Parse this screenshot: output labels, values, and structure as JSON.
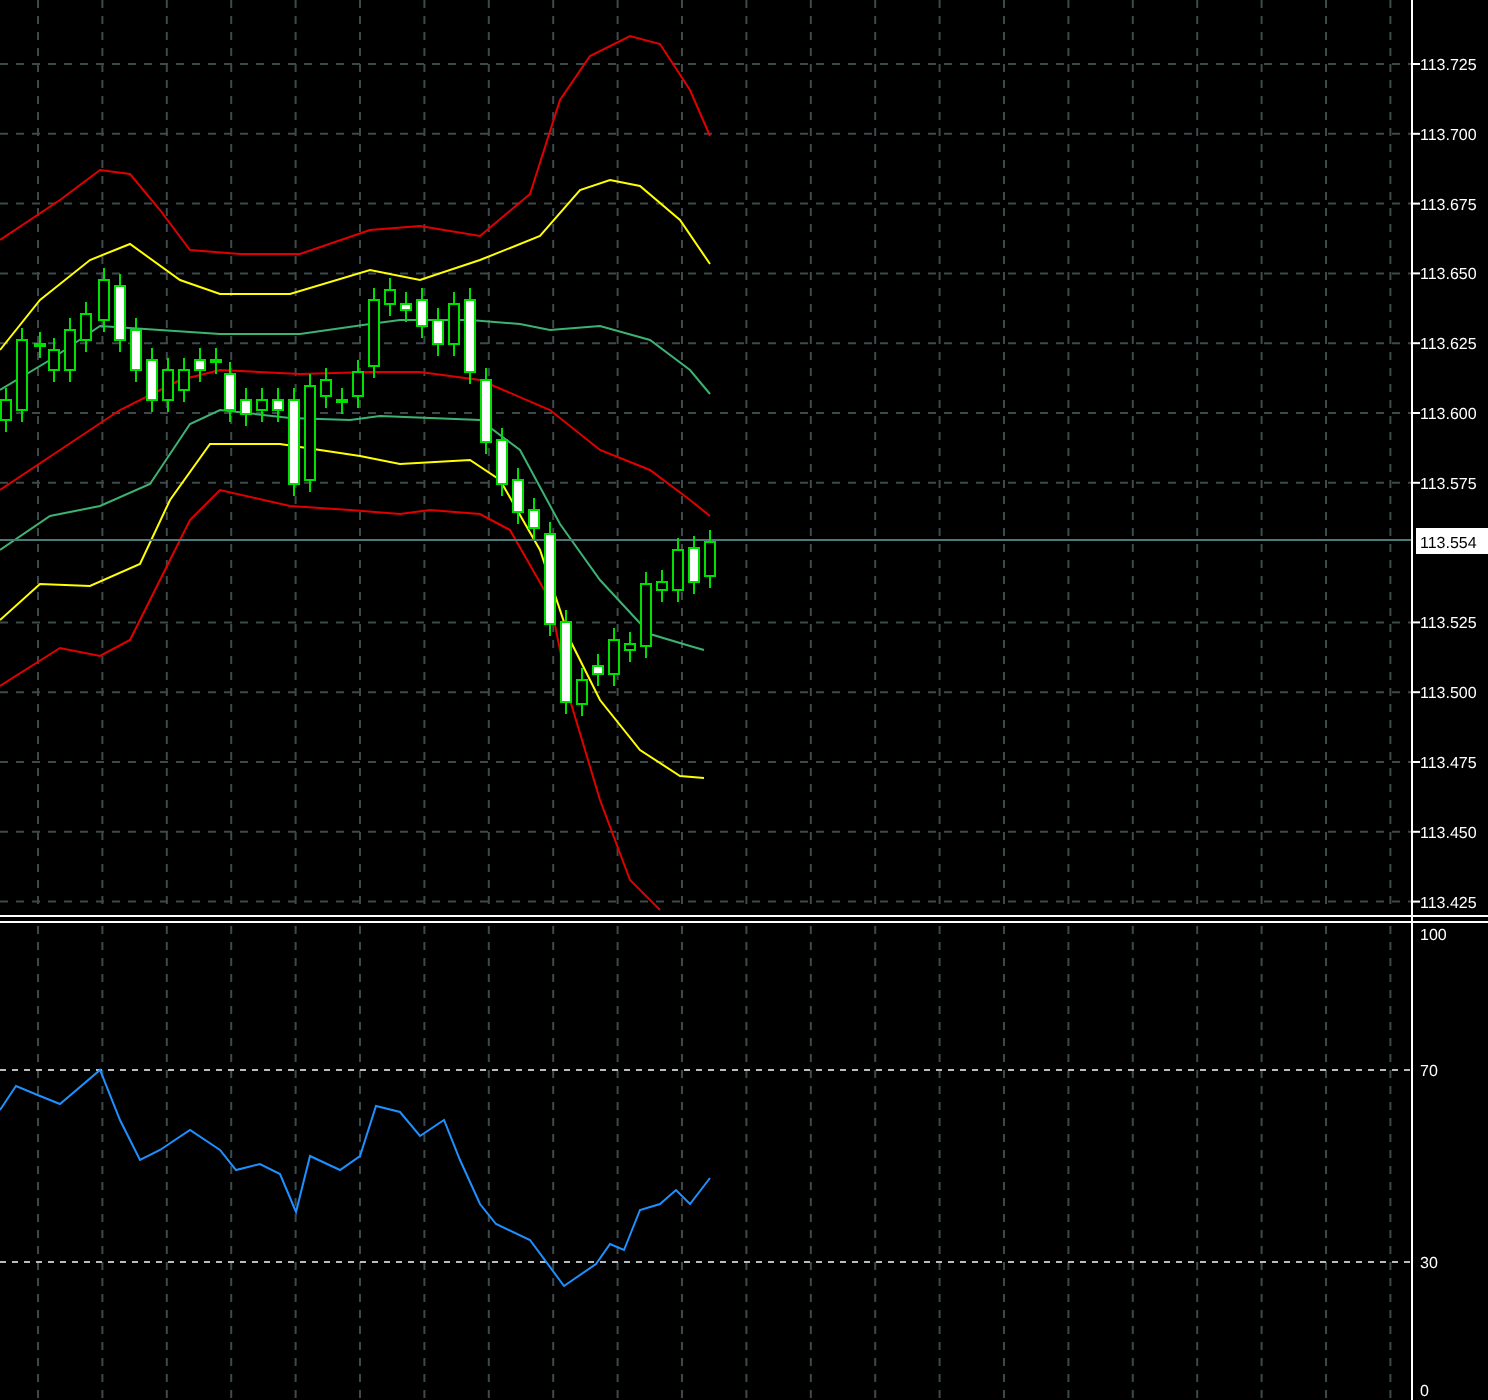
{
  "price_chart": {
    "axis_labels": [
      "113.725",
      "113.700",
      "113.675",
      "113.650",
      "113.625",
      "113.600",
      "113.575",
      "113.525",
      "113.500",
      "113.475",
      "113.450",
      "113.425"
    ],
    "current_price": "113.554"
  },
  "rsi_panel": {
    "axis_labels": [
      "100",
      "70",
      "30",
      "0"
    ]
  }
}
